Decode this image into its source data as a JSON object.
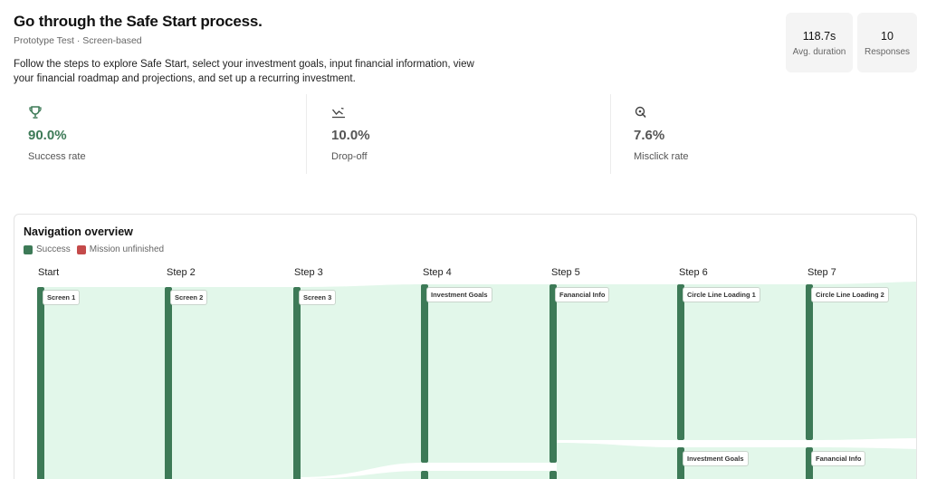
{
  "header": {
    "title": "Go through the Safe Start process.",
    "subtitle": "Prototype Test · Screen-based",
    "description": "Follow the steps to explore Safe Start, select your investment goals, input financial information, view your financial roadmap and projections, and set up a recurring investment."
  },
  "stats": {
    "duration_value": "118.7s",
    "duration_label": "Avg. duration",
    "responses_value": "10",
    "responses_label": "Responses"
  },
  "metrics": {
    "success": {
      "value": "90.0%",
      "label": "Success rate",
      "icon": "trophy-icon"
    },
    "dropoff": {
      "value": "10.0%",
      "label": "Drop-off",
      "icon": "trend-down-icon"
    },
    "misclick": {
      "value": "7.6%",
      "label": "Misclick rate",
      "icon": "cursor-click-icon"
    }
  },
  "navigation": {
    "title": "Navigation overview",
    "legend": [
      {
        "label": "Success",
        "color": "#3d7a57"
      },
      {
        "label": "Mission unfinished",
        "color": "#c44a4a"
      }
    ],
    "steps": [
      "Start",
      "Step 2",
      "Step 3",
      "Step 4",
      "Step 5",
      "Step 6",
      "Step 7"
    ],
    "nodes": {
      "s1": "Screen 1",
      "s2": "Screen 2",
      "s3": "Screen 3",
      "s4": "Investment Goals",
      "s5": "Fanancial Info",
      "s6": "Circle Line Loading 1",
      "s7": "Circle Line Loading 2",
      "s6b": "Investment Goals",
      "s7b": "Fanancial Info"
    },
    "colors": {
      "bar": "#3d7a57",
      "flow": "#e2f7ea",
      "flow_edge": "#d4efdd"
    }
  }
}
